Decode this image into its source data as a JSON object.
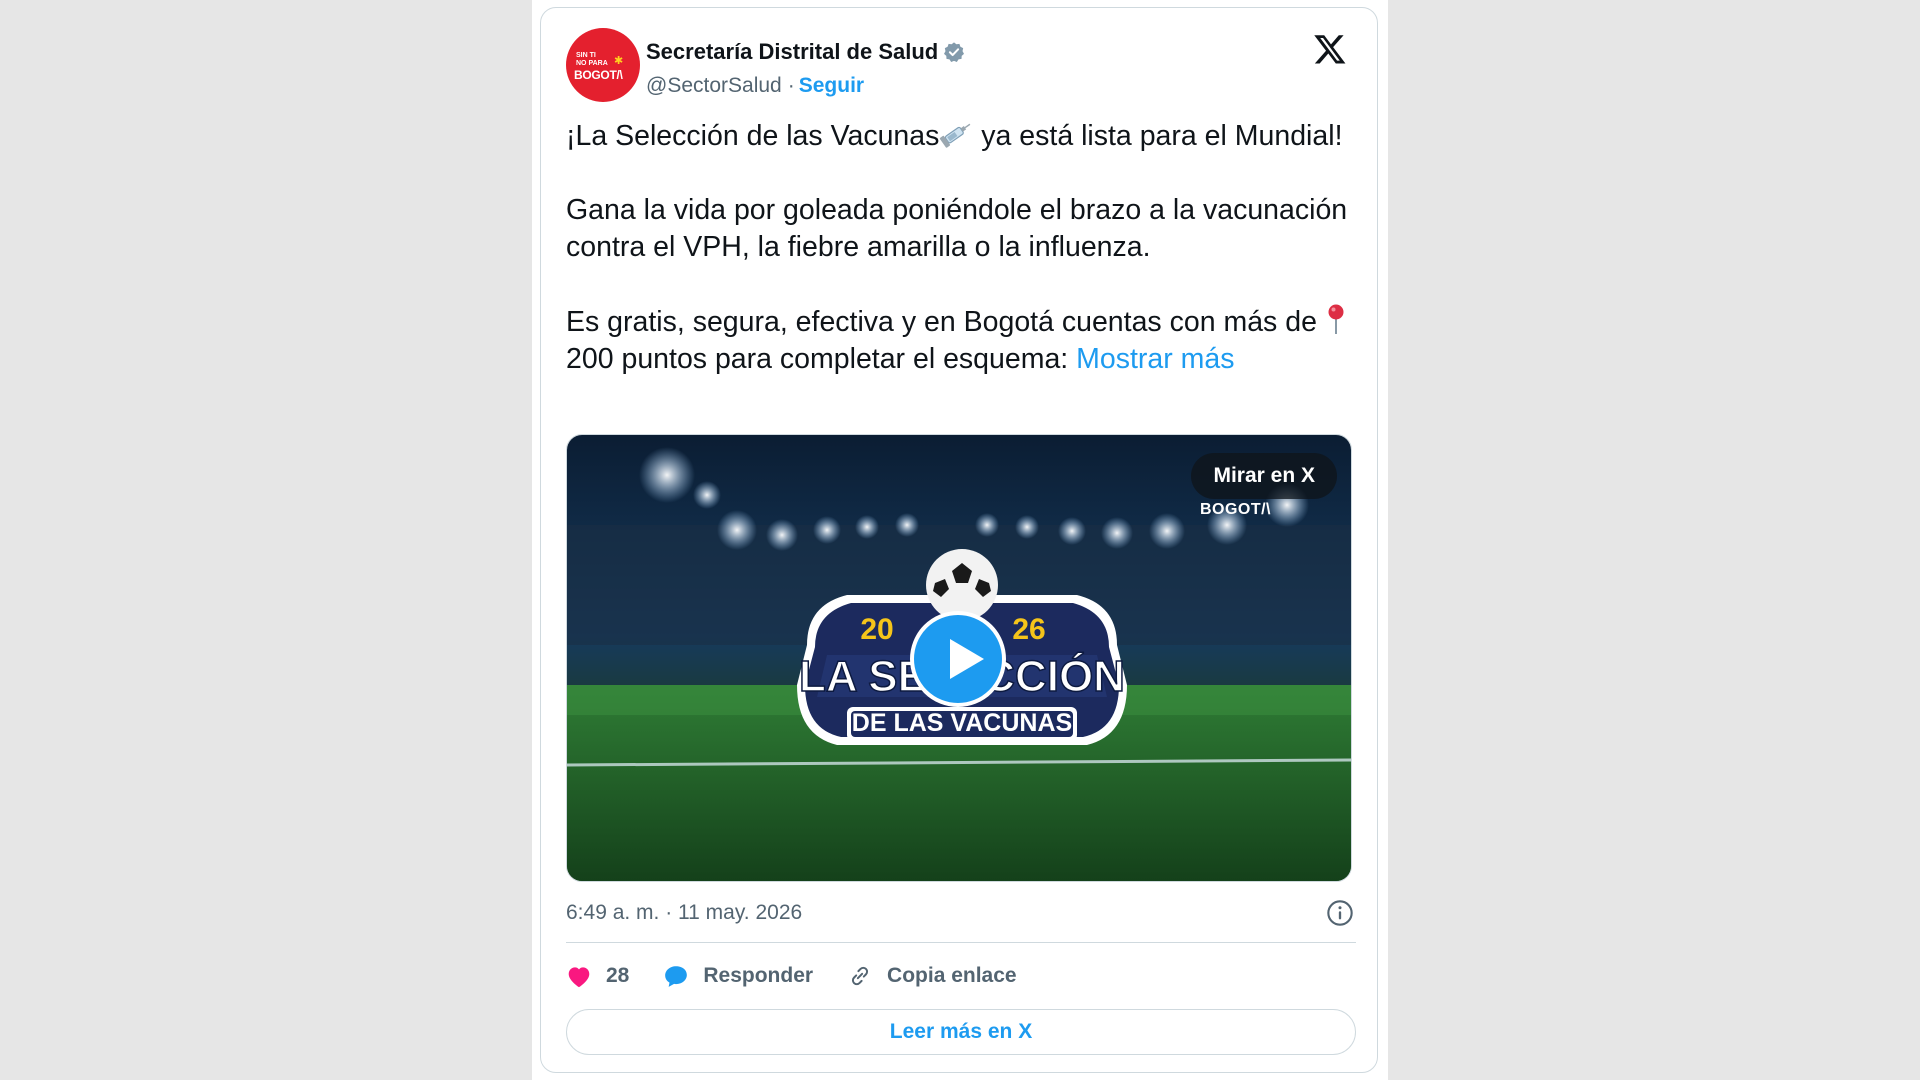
{
  "tweet": {
    "author": {
      "name": "Secretaría Distrital de Salud",
      "handle": "@SectorSalud",
      "separator": "·",
      "follow_label": "Seguir",
      "avatar_text_1": "SIN TI\nNO PARA",
      "avatar_text_2": "BOGOT/\\",
      "avatar_text_3": "✱"
    },
    "text": {
      "p1_before": "¡La Selección de las Vacunas",
      "p1_after": " ya está lista para el Mundial!",
      "p2": "Gana la vida por goleada poniéndole el brazo a la vacunación contra el VPH, la fiebre amarilla o la influenza.",
      "p3_before": "Es gratis, segura, efectiva y en Bogotá cuentas con más de ",
      "p3_after": " 200 puntos para completar el esquema: ",
      "show_more": "Mostrar más"
    },
    "media": {
      "watch_label": "Mirar en X",
      "watermark": "BOGOT/\\",
      "year_left": "20",
      "year_right": "26",
      "title_line1": "LA SELECCIÓN",
      "title_line2": "DE LAS VACUNAS"
    },
    "timestamp": "6:49 a. m. · 11 may. 2026",
    "actions": {
      "likes": "28",
      "reply_label": "Responder",
      "copy_label": "Copia enlace"
    },
    "read_more_label": "Leer más en X"
  },
  "colors": {
    "accent": "#1d9bf0",
    "like": "#f91880",
    "avatar_bg": "#e4202e",
    "secondary_text": "#536471"
  },
  "icons": [
    "verified-badge-icon",
    "x-logo-icon",
    "syringe-icon",
    "round-pushpin-icon",
    "play-icon",
    "info-icon",
    "heart-icon",
    "reply-bubble-icon",
    "link-icon"
  ]
}
